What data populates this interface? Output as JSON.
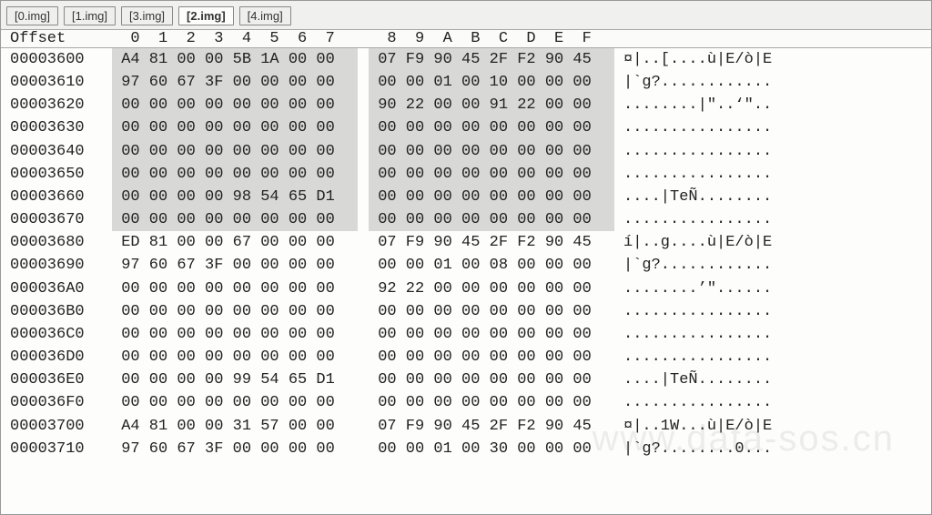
{
  "tabs": [
    {
      "label": "[0.img]",
      "active": false
    },
    {
      "label": "[1.img]",
      "active": false
    },
    {
      "label": "[3.img]",
      "active": false
    },
    {
      "label": "[2.img]",
      "active": true
    },
    {
      "label": "[4.img]",
      "active": false
    }
  ],
  "header": {
    "offset_label": "Offset",
    "cols": [
      "0",
      "1",
      "2",
      "3",
      "4",
      "5",
      "6",
      "7",
      "8",
      "9",
      "A",
      "B",
      "C",
      "D",
      "E",
      "F"
    ]
  },
  "highlight_rows": 8,
  "rows": [
    {
      "offset": "00003600",
      "hex": [
        "A4",
        "81",
        "00",
        "00",
        "5B",
        "1A",
        "00",
        "00",
        "07",
        "F9",
        "90",
        "45",
        "2F",
        "F2",
        "90",
        "45"
      ],
      "ascii": "¤|..[....ù|E/ò|E"
    },
    {
      "offset": "00003610",
      "hex": [
        "97",
        "60",
        "67",
        "3F",
        "00",
        "00",
        "00",
        "00",
        "00",
        "00",
        "01",
        "00",
        "10",
        "00",
        "00",
        "00"
      ],
      "ascii": "|`g?............"
    },
    {
      "offset": "00003620",
      "hex": [
        "00",
        "00",
        "00",
        "00",
        "00",
        "00",
        "00",
        "00",
        "90",
        "22",
        "00",
        "00",
        "91",
        "22",
        "00",
        "00"
      ],
      "ascii": "........|\"..‘\".."
    },
    {
      "offset": "00003630",
      "hex": [
        "00",
        "00",
        "00",
        "00",
        "00",
        "00",
        "00",
        "00",
        "00",
        "00",
        "00",
        "00",
        "00",
        "00",
        "00",
        "00"
      ],
      "ascii": "................"
    },
    {
      "offset": "00003640",
      "hex": [
        "00",
        "00",
        "00",
        "00",
        "00",
        "00",
        "00",
        "00",
        "00",
        "00",
        "00",
        "00",
        "00",
        "00",
        "00",
        "00"
      ],
      "ascii": "................"
    },
    {
      "offset": "00003650",
      "hex": [
        "00",
        "00",
        "00",
        "00",
        "00",
        "00",
        "00",
        "00",
        "00",
        "00",
        "00",
        "00",
        "00",
        "00",
        "00",
        "00"
      ],
      "ascii": "................"
    },
    {
      "offset": "00003660",
      "hex": [
        "00",
        "00",
        "00",
        "00",
        "98",
        "54",
        "65",
        "D1",
        "00",
        "00",
        "00",
        "00",
        "00",
        "00",
        "00",
        "00"
      ],
      "ascii": "....|TeÑ........"
    },
    {
      "offset": "00003670",
      "hex": [
        "00",
        "00",
        "00",
        "00",
        "00",
        "00",
        "00",
        "00",
        "00",
        "00",
        "00",
        "00",
        "00",
        "00",
        "00",
        "00"
      ],
      "ascii": "................"
    },
    {
      "offset": "00003680",
      "hex": [
        "ED",
        "81",
        "00",
        "00",
        "67",
        "00",
        "00",
        "00",
        "07",
        "F9",
        "90",
        "45",
        "2F",
        "F2",
        "90",
        "45"
      ],
      "ascii": "í|..g....ù|E/ò|E"
    },
    {
      "offset": "00003690",
      "hex": [
        "97",
        "60",
        "67",
        "3F",
        "00",
        "00",
        "00",
        "00",
        "00",
        "00",
        "01",
        "00",
        "08",
        "00",
        "00",
        "00"
      ],
      "ascii": "|`g?............"
    },
    {
      "offset": "000036A0",
      "hex": [
        "00",
        "00",
        "00",
        "00",
        "00",
        "00",
        "00",
        "00",
        "92",
        "22",
        "00",
        "00",
        "00",
        "00",
        "00",
        "00"
      ],
      "ascii": "........’\"......"
    },
    {
      "offset": "000036B0",
      "hex": [
        "00",
        "00",
        "00",
        "00",
        "00",
        "00",
        "00",
        "00",
        "00",
        "00",
        "00",
        "00",
        "00",
        "00",
        "00",
        "00"
      ],
      "ascii": "................"
    },
    {
      "offset": "000036C0",
      "hex": [
        "00",
        "00",
        "00",
        "00",
        "00",
        "00",
        "00",
        "00",
        "00",
        "00",
        "00",
        "00",
        "00",
        "00",
        "00",
        "00"
      ],
      "ascii": "................"
    },
    {
      "offset": "000036D0",
      "hex": [
        "00",
        "00",
        "00",
        "00",
        "00",
        "00",
        "00",
        "00",
        "00",
        "00",
        "00",
        "00",
        "00",
        "00",
        "00",
        "00"
      ],
      "ascii": "................"
    },
    {
      "offset": "000036E0",
      "hex": [
        "00",
        "00",
        "00",
        "00",
        "99",
        "54",
        "65",
        "D1",
        "00",
        "00",
        "00",
        "00",
        "00",
        "00",
        "00",
        "00"
      ],
      "ascii": "....|TeÑ........"
    },
    {
      "offset": "000036F0",
      "hex": [
        "00",
        "00",
        "00",
        "00",
        "00",
        "00",
        "00",
        "00",
        "00",
        "00",
        "00",
        "00",
        "00",
        "00",
        "00",
        "00"
      ],
      "ascii": "................"
    },
    {
      "offset": "00003700",
      "hex": [
        "A4",
        "81",
        "00",
        "00",
        "31",
        "57",
        "00",
        "00",
        "07",
        "F9",
        "90",
        "45",
        "2F",
        "F2",
        "90",
        "45"
      ],
      "ascii": "¤|..1W...ù|E/ò|E"
    },
    {
      "offset": "00003710",
      "hex": [
        "97",
        "60",
        "67",
        "3F",
        "00",
        "00",
        "00",
        "00",
        "00",
        "00",
        "01",
        "00",
        "30",
        "00",
        "00",
        "00"
      ],
      "ascii": "|`g?........0..."
    }
  ],
  "watermark": "www.data-sos.cn"
}
